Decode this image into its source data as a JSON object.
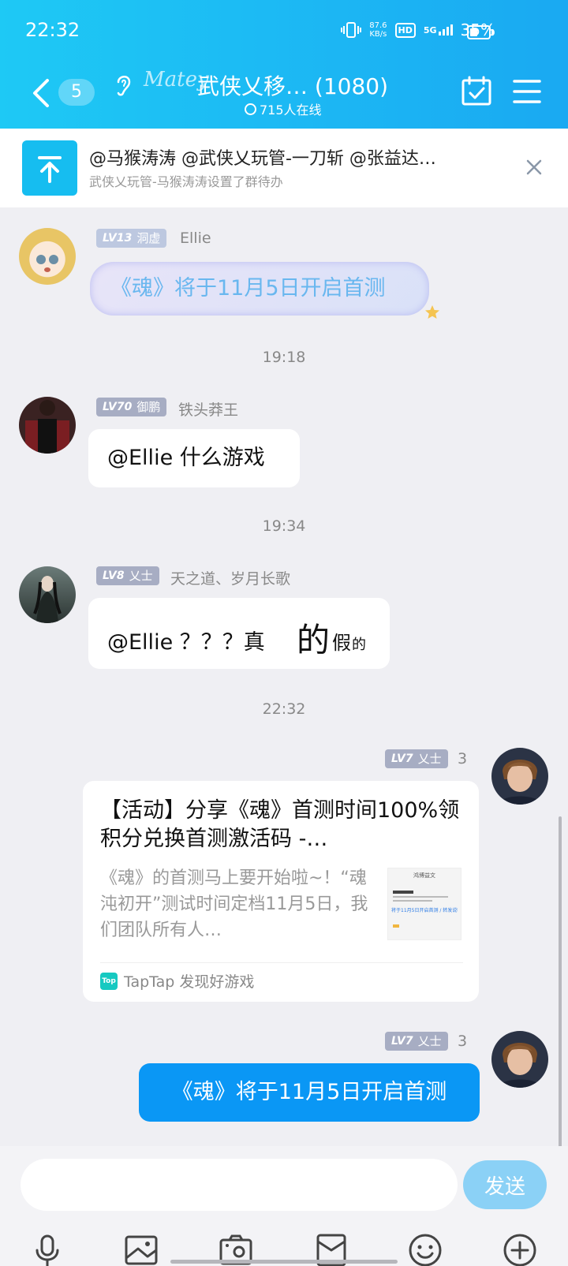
{
  "status_bar": {
    "time": "22:32",
    "net_speed": "87.6",
    "net_unit": "KB/s",
    "hd": "HD",
    "signal": "5G",
    "battery": "35%"
  },
  "header": {
    "back_count": "5",
    "brand": "Matey",
    "title": "武侠乂移…",
    "member_count": "(1080)",
    "online": "715人在线"
  },
  "banner": {
    "mentions": "@马猴涛涛  @武侠乂玩管-一刀斩  @张益达…",
    "subtitle": "武侠乂玩管-马猴涛涛设置了群待办"
  },
  "messages": [
    {
      "level": "LV13",
      "rank": "洞虚",
      "nick": "Ellie",
      "text": "《魂》将于11月5日开启首测"
    },
    {
      "time": "19:18"
    },
    {
      "level": "LV70",
      "rank": "御鹏",
      "nick": "铁头莽王",
      "text": "@Ellie  什么游戏"
    },
    {
      "time": "19:34"
    },
    {
      "level": "LV8",
      "rank": "乂士",
      "nick": "天之道、岁月长歌",
      "text_a": "@Ellie   ？？？真",
      "text_b": "的",
      "text_c": "假",
      "text_d": "的"
    },
    {
      "time": "22:32"
    },
    {
      "level": "LV7",
      "rank": "乂士",
      "nick": "3"
    },
    {
      "level": "LV7",
      "rank": "乂士",
      "nick": "3",
      "text": "《魂》将于11月5日开启首测"
    }
  ],
  "card": {
    "title": "【活动】分享《魂》首测时间100%领积分兑换首测激活码 -…",
    "desc": "《魂》的首测马上要开始啦~！“魂沌初开”测试时间定档11月5日，我们团队所有人…",
    "thumb_title": "鸿博益文",
    "thumb_link": "将于11月5日开启首测 / 转发说明",
    "source_logo": "Top",
    "source": "TapTap 发现好游戏"
  },
  "composer": {
    "placeholder": "",
    "send": "发送"
  },
  "colors": {
    "header_start": "#1ec9f5",
    "header_end": "#1aa9f2",
    "my_bubble": "#0a97f5",
    "send_button": "#8bd1f6"
  },
  "toolbar_icons": [
    "mic-icon",
    "image-icon",
    "camera-icon",
    "red-packet-icon",
    "emoji-icon",
    "plus-icon"
  ]
}
